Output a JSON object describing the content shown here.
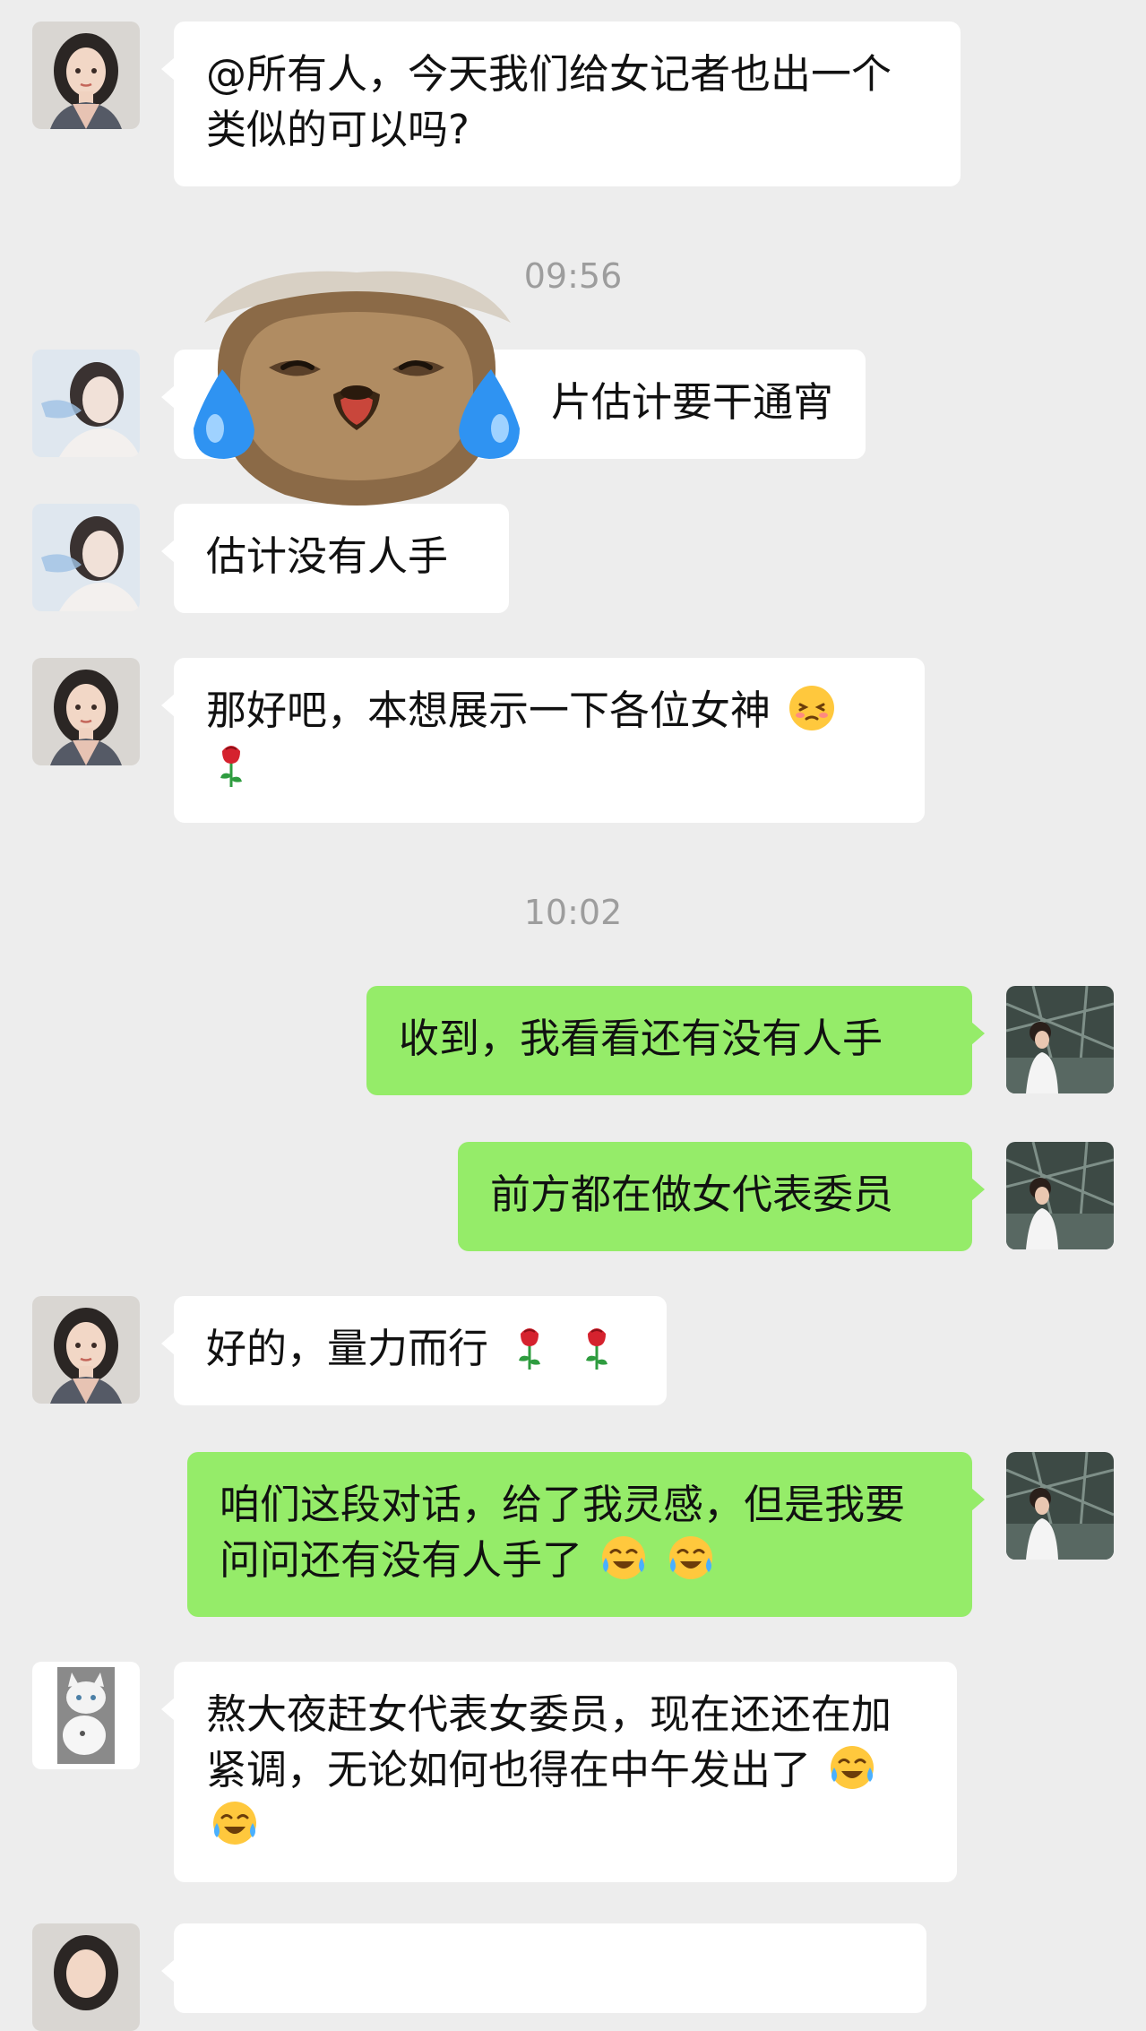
{
  "messages": [
    {
      "text": "@所有人，今天我们给女记者也出一个类似的可以吗?"
    },
    {
      "text": "片估计要干通宵"
    },
    {
      "text": "估计没有人手"
    },
    {
      "text": "那好吧，本想展示一下各位女神"
    },
    {
      "text": "收到，我看看还有没有人手"
    },
    {
      "text": "前方都在做女代表委员"
    },
    {
      "text": "好的，量力而行"
    },
    {
      "text": "咱们这段对话，给了我灵感，但是我要问问还有没有人手了"
    },
    {
      "text": "熬大夜赶女代表女委员，现在还还在加紧调，无论如何也得在中午发出了"
    }
  ],
  "timestamps": [
    "09:56",
    "10:02"
  ],
  "icons": {
    "emoji_shy": "shy-face-icon",
    "emoji_rose": "rose-icon",
    "emoji_cry_laugh": "tears-of-joy-icon",
    "sticker": "crying-sloth-sticker"
  },
  "colors": {
    "background": "#ededed",
    "incoming_bubble": "#ffffff",
    "outgoing_bubble": "#95ec69",
    "timestamp": "#9d9d9d"
  }
}
